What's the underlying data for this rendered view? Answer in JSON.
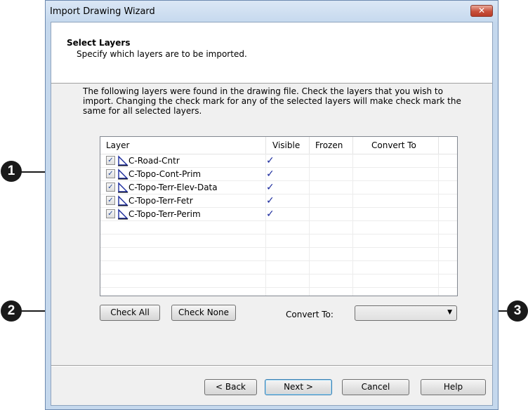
{
  "window": {
    "title": "Import Drawing Wizard",
    "close_label": "✕"
  },
  "header": {
    "title": "Select Layers",
    "subtitle": "Specify which layers are to be imported."
  },
  "instructions": "The following layers were found in the drawing file. Check the layers that you wish to import. Changing the check mark for any of the selected layers will make check mark the same for all selected layers.",
  "layer_table": {
    "columns": [
      "Layer",
      "Visible",
      "Frozen",
      "Convert To"
    ],
    "rows": [
      {
        "checked": true,
        "icon": "layer-icon",
        "name": "C-Road-Cntr",
        "visible": "✓",
        "frozen": "",
        "convert_to": ""
      },
      {
        "checked": true,
        "icon": "layer-icon",
        "name": "C-Topo-Cont-Prim",
        "visible": "✓",
        "frozen": "",
        "convert_to": ""
      },
      {
        "checked": true,
        "icon": "layer-icon",
        "name": "C-Topo-Terr-Elev-Data",
        "visible": "✓",
        "frozen": "",
        "convert_to": ""
      },
      {
        "checked": true,
        "icon": "layer-icon",
        "name": "C-Topo-Terr-Fetr",
        "visible": "✓",
        "frozen": "",
        "convert_to": ""
      },
      {
        "checked": true,
        "icon": "layer-icon",
        "name": "C-Topo-Terr-Perim",
        "visible": "✓",
        "frozen": "",
        "convert_to": ""
      }
    ]
  },
  "buttons": {
    "check_all": "Check All",
    "check_none": "Check None",
    "back": "< Back",
    "next": "Next >",
    "cancel": "Cancel",
    "help": "Help"
  },
  "convert_to": {
    "label": "Convert To:",
    "value": ""
  },
  "callouts": [
    "1",
    "2",
    "3"
  ],
  "colors": {
    "checkmark": "#1a2a9c",
    "close_button": "#c8503b",
    "frame": "#c5d8ed"
  }
}
